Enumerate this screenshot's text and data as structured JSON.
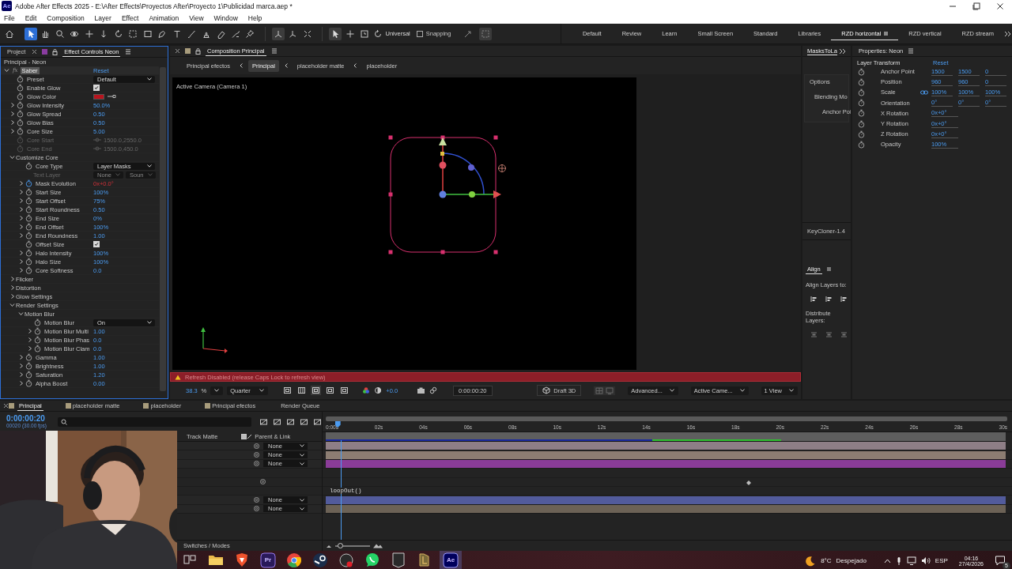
{
  "window": {
    "app_icon": "Ae",
    "title": "Adobe After Effects 2025 - E:\\After Effects\\Proyectos After\\Proyecto 1\\Publicidad marca.aep *"
  },
  "menu": [
    "File",
    "Edit",
    "Composition",
    "Layer",
    "Effect",
    "Animation",
    "View",
    "Window",
    "Help"
  ],
  "toolbar": {
    "tools": [
      {
        "selected": false
      },
      {
        "selected": true
      },
      {
        "selected": false
      },
      {
        "selected": false
      },
      {
        "selected": false
      },
      {
        "selected": false
      },
      {
        "selected": false
      },
      {
        "selected": false
      },
      {
        "selected": false
      },
      {
        "selected": false
      },
      {
        "selected": false
      },
      {
        "selected": false
      },
      {
        "selected": false
      },
      {
        "selected": false
      },
      {
        "selected": false
      },
      {
        "selected": false
      },
      {
        "selected": false
      }
    ],
    "axis_modes": [
      {
        "selected": true
      },
      {
        "selected": false
      },
      {
        "selected": false
      }
    ],
    "view_tools": [
      {
        "selected": true
      },
      {
        "selected": false
      },
      {
        "selected": false
      }
    ],
    "axis_label": "Universal",
    "snapping": {
      "label": "Snapping",
      "checked": false
    }
  },
  "workspaces": [
    {
      "label": "Default",
      "selected": false
    },
    {
      "label": "Review",
      "selected": false
    },
    {
      "label": "Learn",
      "selected": false
    },
    {
      "label": "Small Screen",
      "selected": false
    },
    {
      "label": "Standard",
      "selected": false
    },
    {
      "label": "Libraries",
      "selected": false
    },
    {
      "label": "RZD horizontal",
      "selected": true
    },
    {
      "label": "RZD vertical",
      "selected": false
    },
    {
      "label": "RZD stream",
      "selected": false
    }
  ],
  "left_panel": {
    "tabs": [
      {
        "label": "Project",
        "selected": false
      },
      {
        "label": "Effect Controls Neon",
        "selected": true
      }
    ],
    "layer_path": "Principal - Neon",
    "effect": {
      "badge": "fx",
      "name": "Saber",
      "reset": "Reset",
      "expanded": true,
      "items": [
        {
          "kind": "dropdown",
          "name": "Preset",
          "value": "Default"
        },
        {
          "kind": "checkbox",
          "name": "Enable Glow",
          "checked": true
        },
        {
          "kind": "color",
          "name": "Glow Color",
          "color": "#b8141e"
        },
        {
          "kind": "value",
          "name": "Glow Intensity",
          "value": "50.0%",
          "expandable": true
        },
        {
          "kind": "value",
          "name": "Glow Spread",
          "value": "0.50",
          "expandable": true
        },
        {
          "kind": "value",
          "name": "Glow Bias",
          "value": "0.50",
          "expandable": true
        },
        {
          "kind": "value",
          "name": "Core Size",
          "value": "5.00",
          "expandable": true
        },
        {
          "kind": "point",
          "name": "Core Start",
          "value": "1500.0,2550.0",
          "disabled": true
        },
        {
          "kind": "point",
          "name": "Core End",
          "value": "1500.0,450.0",
          "disabled": true
        },
        {
          "kind": "group",
          "name": "Customize Core",
          "expanded": true,
          "children": [
            {
              "kind": "dropdown",
              "name": "Core Type",
              "value": "Layer Masks"
            },
            {
              "kind": "selects",
              "name": "Text Layer",
              "values": [
                "None",
                "Soun"
              ],
              "disabled": true
            },
            {
              "kind": "value",
              "name": "Mask Evolution",
              "value": "0x+0.0°",
              "expandable": true,
              "keyframed": true
            },
            {
              "kind": "value",
              "name": "Start Size",
              "value": "100%",
              "expandable": true
            },
            {
              "kind": "value",
              "name": "Start Offset",
              "value": "75%",
              "expandable": true
            },
            {
              "kind": "value",
              "name": "Start Roundness",
              "value": "0.50",
              "expandable": true
            },
            {
              "kind": "value",
              "name": "End Size",
              "value": "0%",
              "expandable": true
            },
            {
              "kind": "value",
              "name": "End Offset",
              "value": "100%",
              "expandable": true
            },
            {
              "kind": "value",
              "name": "End Roundness",
              "value": "1.00",
              "expandable": true
            },
            {
              "kind": "checkbox",
              "name": "Offset Size",
              "checked": true
            },
            {
              "kind": "value",
              "name": "Halo Intensity",
              "value": "100%",
              "expandable": true
            },
            {
              "kind": "value",
              "name": "Halo Size",
              "value": "100%",
              "expandable": true
            },
            {
              "kind": "value",
              "name": "Core Softness",
              "value": "0.0",
              "expandable": true
            }
          ]
        },
        {
          "kind": "group",
          "name": "Flicker",
          "expanded": false
        },
        {
          "kind": "group",
          "name": "Distortion",
          "expanded": false
        },
        {
          "kind": "group",
          "name": "Glow Settings",
          "expanded": false
        },
        {
          "kind": "group",
          "name": "Render Settings",
          "expanded": true,
          "children": [
            {
              "kind": "group",
              "name": "Motion Blur",
              "expanded": true,
              "children": [
                {
                  "kind": "dropdown",
                  "name": "Motion Blur",
                  "value": "On"
                },
                {
                  "kind": "value",
                  "name": "Motion Blur Multi",
                  "value": "1.00",
                  "expandable": true
                },
                {
                  "kind": "value",
                  "name": "Motion Blur Phas",
                  "value": "0.0",
                  "expandable": true
                },
                {
                  "kind": "value",
                  "name": "Motion Blur Clam",
                  "value": "0.0",
                  "expandable": true
                }
              ]
            },
            {
              "kind": "value",
              "name": "Gamma",
              "value": "1.00",
              "expandable": true
            },
            {
              "kind": "value",
              "name": "Brightness",
              "value": "1.00",
              "expandable": true
            },
            {
              "kind": "value",
              "name": "Saturation",
              "value": "1.20",
              "expandable": true
            },
            {
              "kind": "value",
              "name": "Alpha Boost",
              "value": "0.00",
              "expandable": true
            }
          ]
        }
      ]
    }
  },
  "composition": {
    "tab": "Composition Principal",
    "breadcrumbs": [
      {
        "label": "Principal efectos",
        "selected": false
      },
      {
        "label": "Principal",
        "selected": true
      },
      {
        "label": "placeholder matte",
        "selected": false
      },
      {
        "label": "placeholder",
        "selected": false
      }
    ],
    "camera": "Active Camera (Camera 1)",
    "warning": "Refresh Disabled (release Caps Lock to refresh view)",
    "controls": {
      "zoom": "38.3",
      "zoom_unit": "%",
      "resolution": "Quarter",
      "exposure": "+0.0",
      "time": "0:00:00:20",
      "renderer": "Draft 3D",
      "view_options": "Advanced...",
      "camera_view": "Active Came...",
      "layout": "1 View"
    }
  },
  "side_panel": {
    "tab": "MasksToLa",
    "options": "Options",
    "fields": [
      "Blending Mo",
      "Anchor Poi"
    ],
    "plugin": "KeyCloner-1.4",
    "align_tab": "Align",
    "align_to": "Align Layers to:",
    "distribute": "Distribute Layers:"
  },
  "properties": {
    "title": "Properties: Neon",
    "section": "Layer Transform",
    "reset": "Reset",
    "rows": [
      {
        "name": "Anchor Point",
        "values": [
          "1500",
          "1500",
          "0"
        ]
      },
      {
        "name": "Position",
        "values": [
          "960",
          "960",
          "0"
        ]
      },
      {
        "name": "Scale",
        "values": [
          "100%",
          "100%",
          "100%"
        ],
        "constrained": true
      },
      {
        "name": "Orientation",
        "values": [
          "0°",
          "0°",
          "0°"
        ]
      },
      {
        "name": "X Rotation",
        "values": [
          "0x+0°"
        ]
      },
      {
        "name": "Y Rotation",
        "values": [
          "0x+0°"
        ]
      },
      {
        "name": "Z Rotation",
        "values": [
          "0x+0°"
        ]
      },
      {
        "name": "Opacity",
        "values": [
          "100%"
        ]
      }
    ]
  },
  "timeline": {
    "tabs": [
      {
        "label": "Principal",
        "selected": true,
        "kind": "composition"
      },
      {
        "label": "placeholder matte",
        "selected": false,
        "kind": "composition"
      },
      {
        "label": "placeholder",
        "selected": false,
        "kind": "composition"
      },
      {
        "label": "Principal efectos",
        "selected": false,
        "kind": "composition"
      },
      {
        "label": "Render Queue",
        "selected": false,
        "kind": "queue"
      }
    ],
    "time": "0:00:00:20",
    "frame_info": "00020 (30.00 fps)",
    "columns": [
      "Track Matte",
      "Parent & Link"
    ],
    "ruler": [
      "0:00s",
      "02s",
      "04s",
      "06s",
      "08s",
      "10s",
      "12s",
      "14s",
      "16s",
      "18s",
      "20s",
      "22s",
      "24s",
      "26s",
      "28s",
      "30s"
    ],
    "playhead": {
      "level": 0.022
    },
    "rows": [
      {
        "kind": "layer",
        "parent": "None",
        "color": "#8e7e86"
      },
      {
        "kind": "layer",
        "parent": "None",
        "color": "#8c7d72"
      },
      {
        "kind": "layer",
        "parent": "None",
        "color": "#8a3c98"
      },
      {
        "kind": "property"
      },
      {
        "kind": "keyframed"
      },
      {
        "kind": "expression",
        "expression": "loopOut()"
      },
      {
        "kind": "layer",
        "parent": "None",
        "color": "#525b9c"
      },
      {
        "kind": "layer",
        "parent": "None",
        "color": "#6c6256"
      }
    ],
    "footer": "Switches / Modes",
    "zoom_slider": {
      "level": 0.15
    }
  },
  "taskbar": {
    "apps": [
      {
        "selected": false
      },
      {
        "selected": false
      },
      {
        "selected": false
      },
      {
        "selected": false,
        "label": "Pr"
      },
      {
        "selected": false
      },
      {
        "selected": false
      },
      {
        "selected": false
      },
      {
        "selected": false
      },
      {
        "selected": false
      },
      {
        "selected": false
      },
      {
        "selected": true,
        "label": "Ae"
      }
    ],
    "weather": {
      "temp": "8°C",
      "condition": "Despejado"
    },
    "language": "ESP",
    "time": "04:16",
    "date": "27/4/2026",
    "notifications": "5"
  }
}
